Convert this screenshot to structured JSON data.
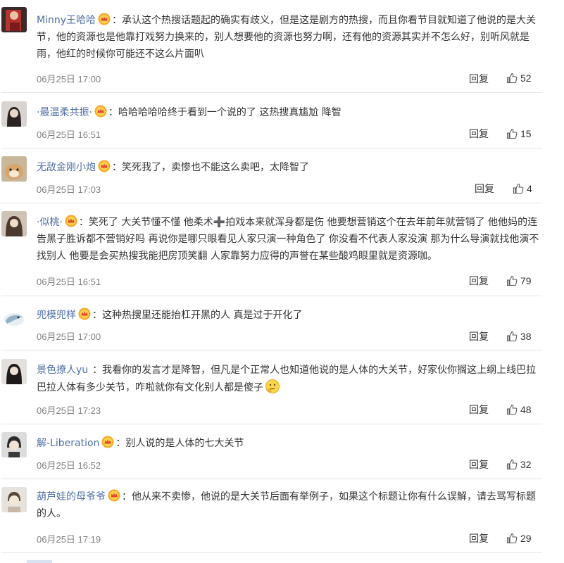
{
  "reply_label": "回复",
  "comments": [
    {
      "user": "Minny王哈哈",
      "colon": "：",
      "text": "承认这个热搜话题起的确实有歧义，但是这是剧方的热搜，而且你看节目就知道了他说的是大关节，他的资源也是他靠打戏努力换来的，别人想要他的资源也努力啊，还有他的资源其实并不怎么好，别听风就是雨，他红的时候你可能还不这么片面叭",
      "time": "06月25日 17:00",
      "likes": "52"
    },
    {
      "user": "·最温柔共振·",
      "colon": "：",
      "text": "哈哈哈哈哈终于看到一个说的了 这热搜真尴尬 降智",
      "time": "06月25日 16:51",
      "likes": "15"
    },
    {
      "user": "无敌金刚小炮",
      "colon": "：",
      "text": "笑死我了，卖惨也不能这么卖吧，太降智了",
      "time": "06月25日 17:03",
      "likes": "4"
    },
    {
      "user": "·似桃·",
      "colon": "：",
      "text": "笑死了 大关节懂不懂 他柔术➕拍戏本来就浑身都是伤 他要想营销这个在去年前年就营销了 他他妈的连告黑子胜诉都不营销好吗 再说你是哪只眼看见人家只演一种角色了 你没看不代表人家没演 那为什么导演就找他演不找别人 他要是会买热搜我能把房顶笑翻 人家靠努力应得的声誉在某些酸鸡眼里就是资源咖。",
      "time": "06月25日 16:51",
      "likes": "79"
    },
    {
      "user": "兜模兜样",
      "colon": "：",
      "text": "这种热搜里还能抬杠开黑的人 真是过于开化了",
      "time": "06月25日 17:00",
      "likes": "38"
    },
    {
      "user": "景色撩人yu",
      "colon": "：",
      "text": "我看你的发言才是降智，但凡是个正常人也知道他说的是人体的大关节，好家伙你搁这上纲上线巴拉巴拉人体有多少关节，咋啦就你有文化别人都是傻子",
      "time": "06月25日 17:23",
      "likes": "48"
    },
    {
      "user": "解-Liberation",
      "colon": "：",
      "text": "别人说的是人体的七大关节",
      "time": "06月25日 16:52",
      "likes": "32"
    },
    {
      "user": "葫芦娃的母爷爷",
      "colon": "：",
      "text": "他从来不卖惨，他说的是大关节后面有举例子，如果这个标题让你有什么误解，请去骂写标题的人。",
      "time": "06月25日 17:19",
      "likes": "29"
    }
  ],
  "colors": {
    "username": "#4e6ea6",
    "text": "#333333",
    "time": "#808080",
    "divider": "#e6e6e6"
  },
  "icons": [
    "vip-crown-icon",
    "thumbs-up-icon",
    "emoji-thinking-icon"
  ]
}
